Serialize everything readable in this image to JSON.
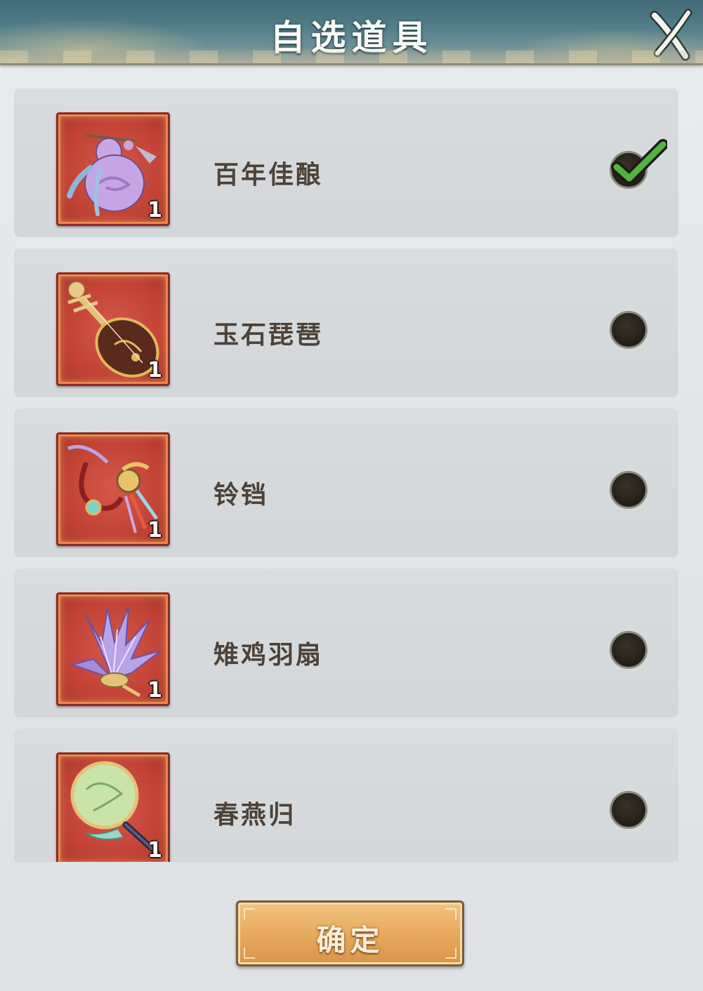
{
  "header": {
    "title": "自选道具"
  },
  "items": [
    {
      "name": "百年佳酿",
      "count": "1",
      "icon": "wine-gourd-icon",
      "selected": true
    },
    {
      "name": "玉石琵琶",
      "count": "1",
      "icon": "pipa-lute-icon",
      "selected": false
    },
    {
      "name": "铃铛",
      "count": "1",
      "icon": "bell-icon",
      "selected": false
    },
    {
      "name": "雉鸡羽扇",
      "count": "1",
      "icon": "feather-fan-icon",
      "selected": false
    },
    {
      "name": "春燕归",
      "count": "1",
      "icon": "round-fan-icon",
      "selected": false
    }
  ],
  "footer": {
    "confirm_label": "确定"
  },
  "colors": {
    "accent": "#e6a85c",
    "selected_check": "#4fae3a",
    "icon_bg": "#c34437"
  }
}
